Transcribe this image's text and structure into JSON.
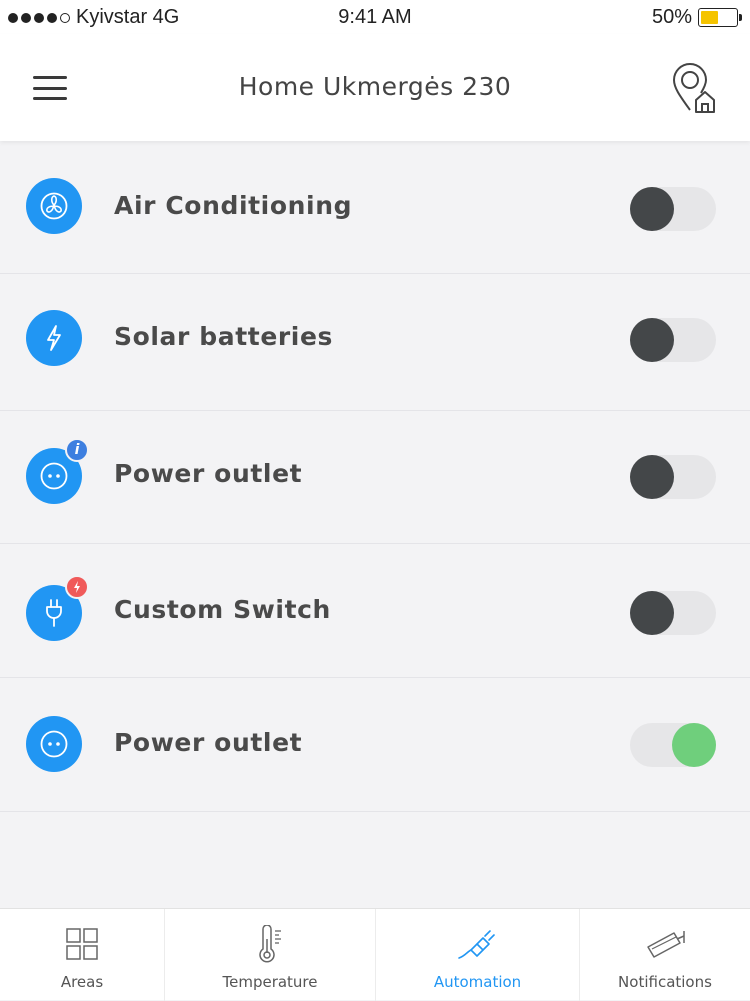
{
  "status_bar": {
    "carrier": "Kyivstar 4G",
    "time": "9:41 AM",
    "battery": "50%",
    "battery_level": 0.5,
    "battery_color": "#f5c400"
  },
  "header": {
    "title": "Home Ukmergės 230",
    "menu_icon": "hamburger-menu-icon",
    "location_icon": "location-pin-home-icon"
  },
  "colors": {
    "accent": "#2196f3",
    "toggle_on": "#6fcf7c",
    "toggle_off_knob": "#444749",
    "info_badge": "#3d7fe0",
    "alert_badge": "#f05a5a"
  },
  "devices": [
    {
      "label": "Air Conditioning",
      "icon": "fan-icon",
      "on": false,
      "badge": null
    },
    {
      "label": "Solar batteries",
      "icon": "lightning-icon",
      "on": false,
      "badge": null
    },
    {
      "label": "Power outlet",
      "icon": "power-outlet-icon",
      "on": false,
      "badge": "info-icon",
      "badge_text": "i"
    },
    {
      "label": "Custom Switch",
      "icon": "plug-icon",
      "on": false,
      "badge": "alert-lightning-icon"
    },
    {
      "label": "Power outlet",
      "icon": "power-outlet-icon",
      "on": true,
      "badge": null
    }
  ],
  "tabs": [
    {
      "label": "Areas",
      "icon": "grid-icon",
      "active": false
    },
    {
      "label": "Temperature",
      "icon": "thermometer-icon",
      "active": false
    },
    {
      "label": "Automation",
      "icon": "plug-icon",
      "active": true
    },
    {
      "label": "Notifications",
      "icon": "security-camera-icon",
      "active": false
    }
  ]
}
